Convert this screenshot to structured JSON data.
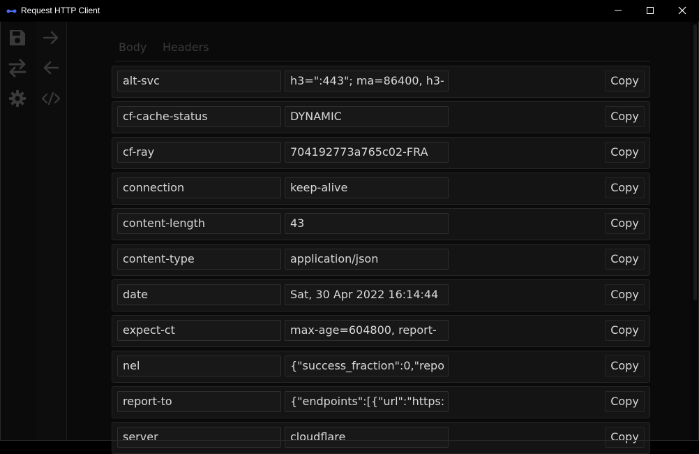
{
  "window": {
    "title": "Request HTTP Client",
    "controls": [
      "minimize",
      "maximize",
      "close"
    ]
  },
  "sidebar": {
    "primary_icons": [
      "save-icon",
      "swap-icon",
      "gear-icon"
    ],
    "secondary_icons": [
      "arrow-right-icon",
      "arrow-left-icon",
      "code-icon"
    ]
  },
  "tabs": [
    {
      "label": "Body"
    },
    {
      "label": "Headers"
    }
  ],
  "copy_label": "Copy",
  "headers": [
    {
      "name": "alt-svc",
      "value": "h3=\":443\"; ma=86400, h3-"
    },
    {
      "name": "cf-cache-status",
      "value": "DYNAMIC"
    },
    {
      "name": "cf-ray",
      "value": "704192773a765c02-FRA"
    },
    {
      "name": "connection",
      "value": "keep-alive"
    },
    {
      "name": "content-length",
      "value": "43"
    },
    {
      "name": "content-type",
      "value": "application/json"
    },
    {
      "name": "date",
      "value": "Sat, 30 Apr 2022 16:14:44"
    },
    {
      "name": "expect-ct",
      "value": "max-age=604800, report-"
    },
    {
      "name": "nel",
      "value": "{\"success_fraction\":0,\"repo"
    },
    {
      "name": "report-to",
      "value": "{\"endpoints\":[{\"url\":\"https:"
    },
    {
      "name": "server",
      "value": "cloudflare"
    }
  ],
  "colors": {
    "background": "#000000",
    "panel": "#141414",
    "text": "#d8d8d8",
    "muted": "#3a3a3a",
    "accent": "#3b6cf0"
  }
}
